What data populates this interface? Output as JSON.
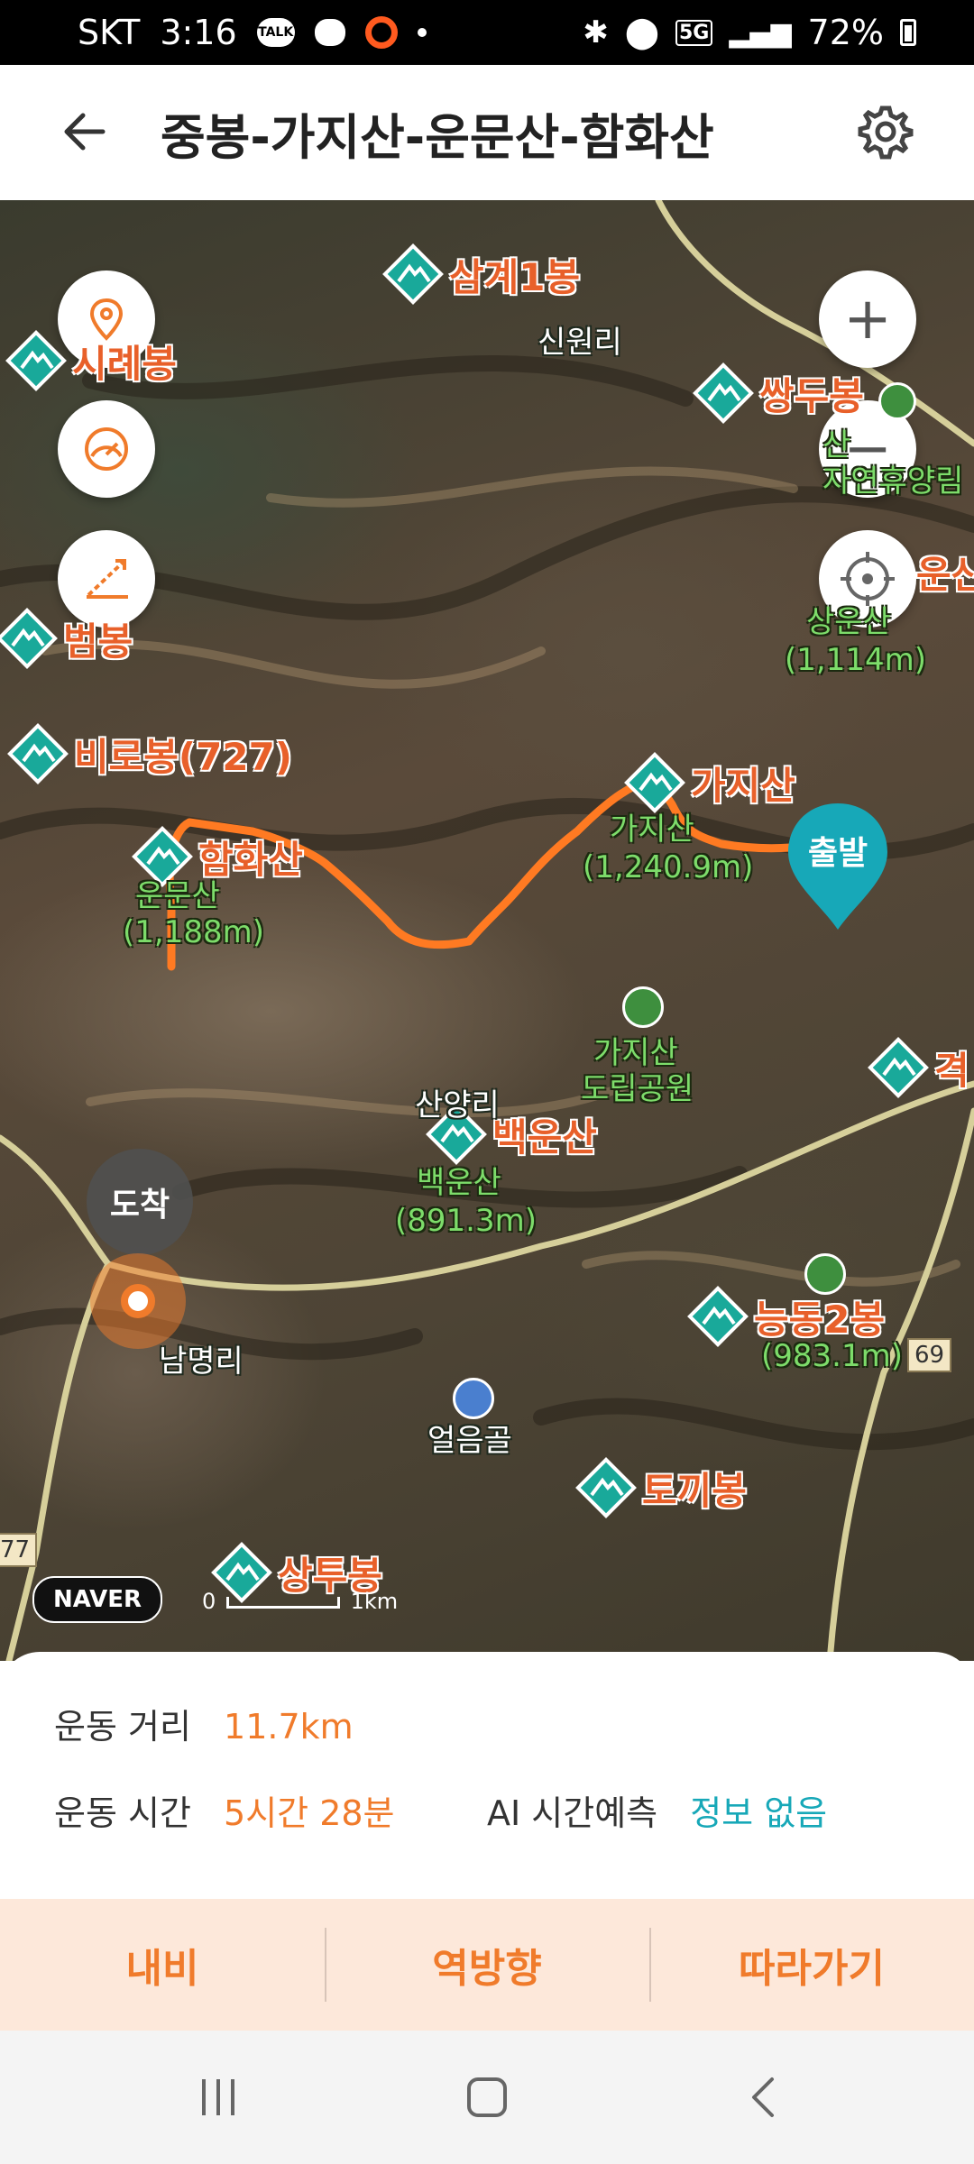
{
  "status_bar": {
    "carrier": "SKT",
    "time": "3:16",
    "talk_badge": "TALK",
    "network": "5G",
    "battery": "72%"
  },
  "header": {
    "title": "중봉-가지산-운문산-함화산"
  },
  "map": {
    "zoom_in": "+",
    "zoom_out": "−",
    "peaks": [
      {
        "name": "삼계1봉"
      },
      {
        "name": "시례봉"
      },
      {
        "name": "쌍두봉"
      },
      {
        "name": "범봉"
      },
      {
        "name": "비로봉(727)"
      },
      {
        "name": "가지산"
      },
      {
        "name": "함화산"
      },
      {
        "name": "백운산"
      },
      {
        "name": "능동2봉"
      },
      {
        "name": "토끼봉"
      },
      {
        "name": "상투봉"
      },
      {
        "name": "격"
      },
      {
        "name": "운산"
      }
    ],
    "labels": {
      "sinwon": "신원리",
      "sanggon_name": "상운산",
      "sanggon_elev": "(1,114m)",
      "gajisan_name": "가지산",
      "gajisan_elev": "(1,240.9m)",
      "unmun_name": "운문산",
      "unmun_elev": "(1,188m)",
      "park_line1": "가지산",
      "park_line2": "도립공원",
      "sanyang": "산양리",
      "baekun_name": "백운산",
      "baekun_elev": "(891.3m)",
      "neungdong_elev": "(983.1m)",
      "nammyeong": "남명리",
      "eoreumgol": "얼음골",
      "forest_line1": "산",
      "forest_line2": "자연휴양림",
      "road_69": "69",
      "road_77": "77"
    },
    "start_label": "출발",
    "arrive_label": "도착",
    "naver_logo": "NAVER",
    "scale_zero": "0",
    "scale_km": "1km"
  },
  "stats": {
    "distance_label": "운동 거리",
    "distance_value": "11.7km",
    "time_label": "운동 시간",
    "time_value": "5시간 28분",
    "ai_label": "AI 시간예측",
    "ai_value": "정보 없음"
  },
  "actions": {
    "navi": "내비",
    "reverse": "역방향",
    "follow": "따라가기"
  },
  "colors": {
    "accent_orange": "#f07b2b",
    "accent_teal": "#17a8b8",
    "action_bg": "#fde8da",
    "route": "#ff7a22"
  }
}
